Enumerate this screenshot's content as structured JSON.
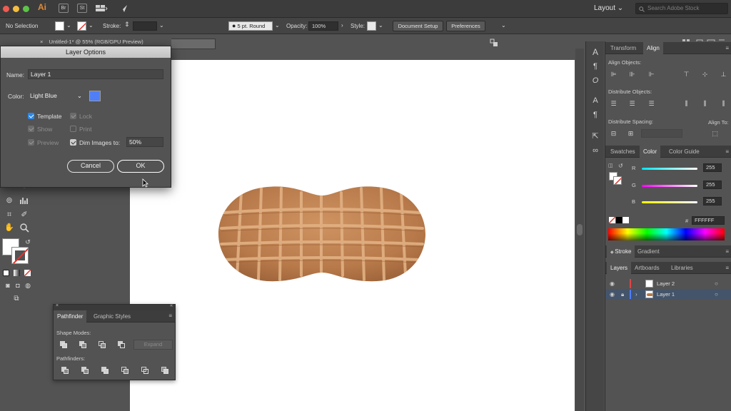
{
  "window": {
    "app_icon": "Ai",
    "title_icons": [
      "Br",
      "St"
    ],
    "workspace": "Layout",
    "stock_search_placeholder": "Search Adobe Stock"
  },
  "controlbar": {
    "selection": "No Selection",
    "stroke_label": "Stroke:",
    "brush": "5 pt. Round",
    "opacity_label": "Opacity:",
    "opacity_value": "100%",
    "style_label": "Style:",
    "document_setup": "Document Setup",
    "preferences": "Preferences"
  },
  "document": {
    "tab_title": "Untitled-1* @ 55% (RGB/GPU Preview)"
  },
  "dialog": {
    "title": "Layer Options",
    "name_label": "Name:",
    "name_value": "Layer 1",
    "color_label": "Color:",
    "color_value": "Light Blue",
    "color_hex": "#4f7ef7",
    "template": "Template",
    "lock": "Lock",
    "show": "Show",
    "print": "Print",
    "preview": "Preview",
    "dim_images": "Dim Images to:",
    "dim_value": "50%",
    "cancel": "Cancel",
    "ok": "OK"
  },
  "align_panel": {
    "tabs": [
      "Transform",
      "Align"
    ],
    "align_objects": "Align Objects:",
    "distribute_objects": "Distribute Objects:",
    "distribute_spacing": "Distribute Spacing:",
    "align_to": "Align To:"
  },
  "color_panel": {
    "tabs": [
      "Swatches",
      "Color",
      "Color Guide"
    ],
    "r_label": "R",
    "g_label": "G",
    "b_label": "B",
    "r": "255",
    "g": "255",
    "b": "255",
    "hex_label": "#",
    "hex": "FFFFFF"
  },
  "stroke_panel": {
    "tabs": [
      "Stroke",
      "Gradient"
    ]
  },
  "layers_panel": {
    "tabs": [
      "Layers",
      "Artboards",
      "Libraries"
    ],
    "layers": [
      {
        "name": "Layer 2",
        "color": "#e04646",
        "selected": false
      },
      {
        "name": "Layer 1",
        "color": "#4f7ef7",
        "selected": true
      }
    ]
  },
  "pathfinder": {
    "tabs": [
      "Pathfinder",
      "Graphic Styles"
    ],
    "shape_modes": "Shape Modes:",
    "expand": "Expand",
    "pathfinders": "Pathfinders:"
  }
}
